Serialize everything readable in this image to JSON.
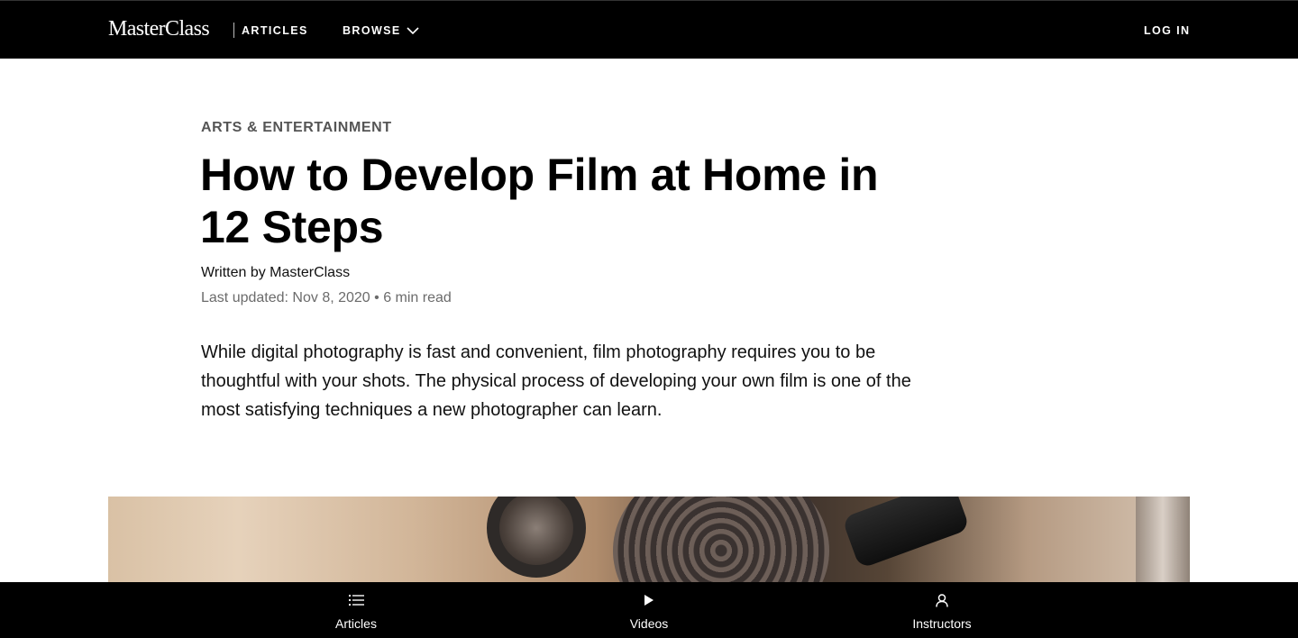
{
  "header": {
    "brand": "MasterClass",
    "section": "ARTICLES",
    "browse_label": "BROWSE",
    "login_label": "LOG IN"
  },
  "article": {
    "category": "ARTS & ENTERTAINMENT",
    "title": "How to Develop Film at Home in 12 Steps",
    "byline": "Written by MasterClass",
    "meta": "Last updated: Nov 8, 2020 • 6 min read",
    "intro": "While digital photography is fast and convenient, film photography requires you to be thoughtful with your shots. The physical process of developing your own film is one of the most satisfying techniques a new photographer can learn."
  },
  "bottom_nav": {
    "items": [
      {
        "label": "Articles",
        "icon": "list-icon"
      },
      {
        "label": "Videos",
        "icon": "play-icon"
      },
      {
        "label": "Instructors",
        "icon": "person-icon"
      }
    ]
  },
  "colors": {
    "nav_background": "#000000",
    "page_background": "#ffffff",
    "category_text": "#555555",
    "meta_text": "#6b6b6b"
  }
}
